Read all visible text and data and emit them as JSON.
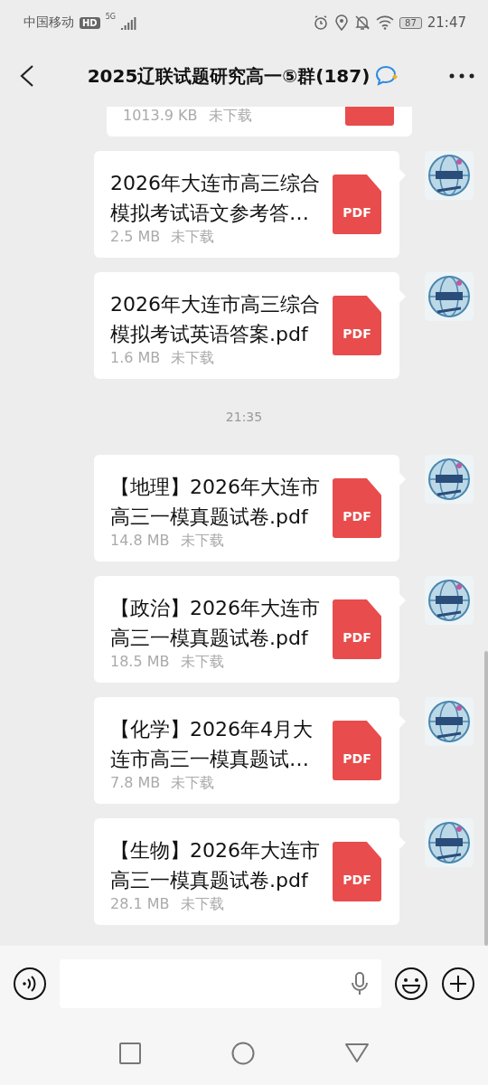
{
  "status_bar": {
    "carrier": "中国移动",
    "hd": "HD",
    "network": "5G",
    "battery": "87",
    "time": "21:47"
  },
  "header": {
    "title": "2025辽联试题研究高一⑤群(187)"
  },
  "messages": [
    {
      "kind": "file",
      "size": "1013.9 KB",
      "status": "未下载"
    },
    {
      "kind": "file",
      "title": "2026年大连市高三综合模拟考试语文参考答…",
      "size": "2.5 MB",
      "status": "未下载",
      "icon": "PDF"
    },
    {
      "kind": "file",
      "title": "2026年大连市高三综合模拟考试英语答案.pdf",
      "size": "1.6 MB",
      "status": "未下载",
      "icon": "PDF"
    },
    {
      "kind": "time",
      "text": "21:35"
    },
    {
      "kind": "file",
      "title": "【地理】2026年大连市高三一模真题试卷.pdf",
      "size": "14.8 MB",
      "status": "未下载",
      "icon": "PDF"
    },
    {
      "kind": "file",
      "title": "【政治】2026年大连市高三一模真题试卷.pdf",
      "size": "18.5 MB",
      "status": "未下载",
      "icon": "PDF"
    },
    {
      "kind": "file",
      "title": "【化学】2026年4月大连市高三一模真题试…",
      "size": "7.8 MB",
      "status": "未下载",
      "icon": "PDF"
    },
    {
      "kind": "file",
      "title": "【生物】2026年大连市高三一模真题试卷.pdf",
      "size": "28.1 MB",
      "status": "未下载",
      "icon": "PDF"
    }
  ]
}
